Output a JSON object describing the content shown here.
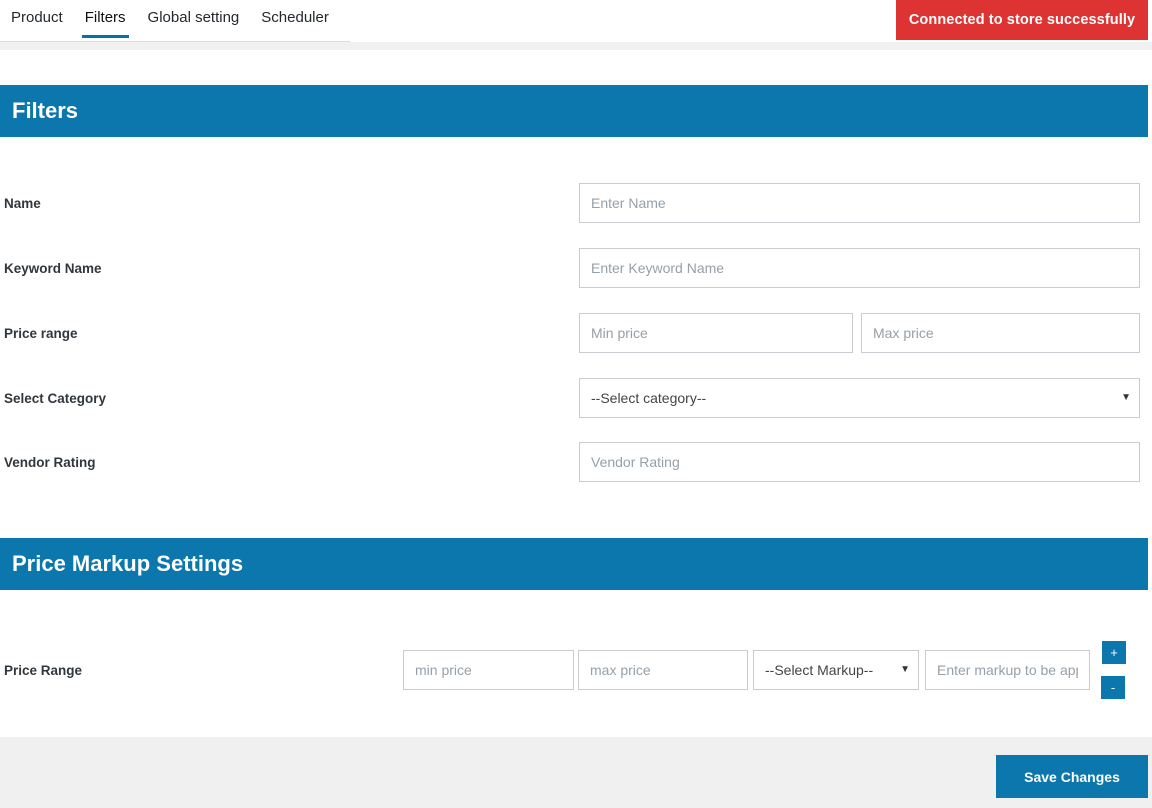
{
  "nav": {
    "tabs": [
      {
        "label": "Product",
        "active": false
      },
      {
        "label": "Filters",
        "active": true
      },
      {
        "label": "Global setting",
        "active": false
      },
      {
        "label": "Scheduler",
        "active": false
      }
    ]
  },
  "banner": {
    "message": "Connected to store successfully",
    "background": "#dd3333",
    "text_color": "#ffffff"
  },
  "theme": {
    "accent": "#0b77ad",
    "panel_header_bg": "#0b77ad",
    "footer_bg": "#f0f0f0",
    "input_border": "#c9cdd1",
    "placeholder_color": "#96a0a8"
  },
  "filters_panel": {
    "title": "Filters",
    "rows": {
      "name": {
        "label": "Name",
        "input": {
          "placeholder": "Enter Name",
          "value": ""
        }
      },
      "keyword_name": {
        "label": "Keyword Name",
        "input": {
          "placeholder": "Enter Keyword Name",
          "value": ""
        }
      },
      "price_range": {
        "label": "Price range",
        "min": {
          "placeholder": "Min price",
          "value": ""
        },
        "max": {
          "placeholder": "Max price",
          "value": ""
        }
      },
      "select_category": {
        "label": "Select Category",
        "select": {
          "selected": "--Select category--",
          "options": [
            "--Select category--"
          ],
          "caret_icon": "chevron-down-icon"
        }
      },
      "vendor_rating": {
        "label": "Vendor Rating",
        "input": {
          "placeholder": "Vendor Rating",
          "value": ""
        }
      }
    }
  },
  "markup_panel": {
    "title": "Price Markup Settings",
    "row": {
      "label": "Price Range",
      "min": {
        "placeholder": "min price",
        "value": ""
      },
      "max": {
        "placeholder": "max price",
        "value": ""
      },
      "markup_type": {
        "selected": "--Select Markup--",
        "options": [
          "--Select Markup--"
        ],
        "caret_icon": "chevron-down-icon"
      },
      "markup_value": {
        "placeholder": "Enter markup to be applied",
        "value": ""
      },
      "add_button": {
        "label": "+",
        "icon": "plus-icon"
      },
      "remove_button": {
        "label": "-",
        "icon": "minus-icon"
      }
    }
  },
  "footer": {
    "save_label": "Save Changes"
  }
}
